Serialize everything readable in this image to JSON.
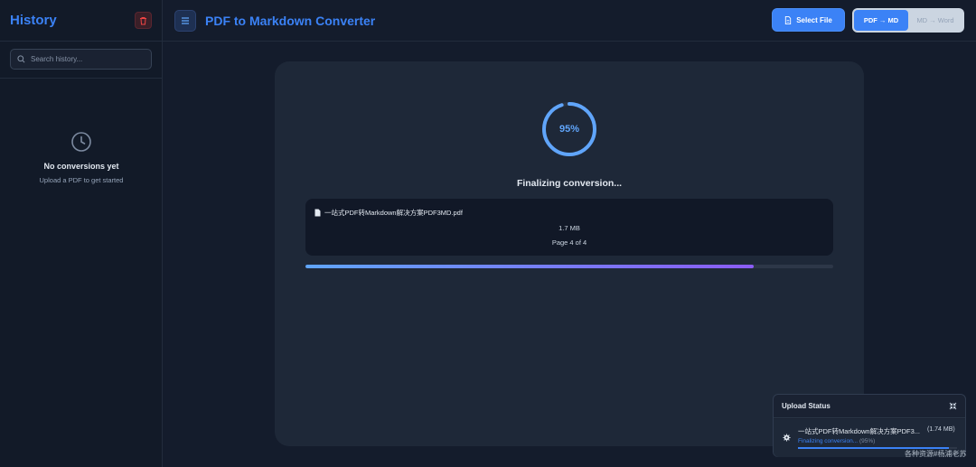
{
  "sidebar": {
    "title": "History",
    "search_placeholder": "Search history...",
    "empty_title": "No conversions yet",
    "empty_subtitle": "Upload a PDF to get started"
  },
  "topbar": {
    "title": "PDF to Markdown Converter",
    "select_file_label": "Select File",
    "modes": [
      {
        "label": "PDF → MD",
        "active": true
      },
      {
        "label": "MD → Word",
        "active": false
      }
    ]
  },
  "conversion": {
    "percent_label": "95%",
    "progress": 0.95,
    "bar_progress": 0.85,
    "status": "Finalizing conversion...",
    "file_name": "一站式PDF转Markdown解决方案PDF3MD.pdf",
    "file_size": "1.7 MB",
    "page_info": "Page 4 of 4"
  },
  "upload_status": {
    "title": "Upload Status",
    "file_name": "一站式PDF转Markdown解决方案PDF3...",
    "file_size": "(1.74 MB)",
    "status": "Finalizing conversion...",
    "percent": "(95%)",
    "progress": 0.95
  },
  "watermark": "各种资源#杨浦老苏",
  "colors": {
    "accent": "#3b82f6",
    "danger": "#ef4444",
    "gradient_end": "#8b5cf6"
  }
}
